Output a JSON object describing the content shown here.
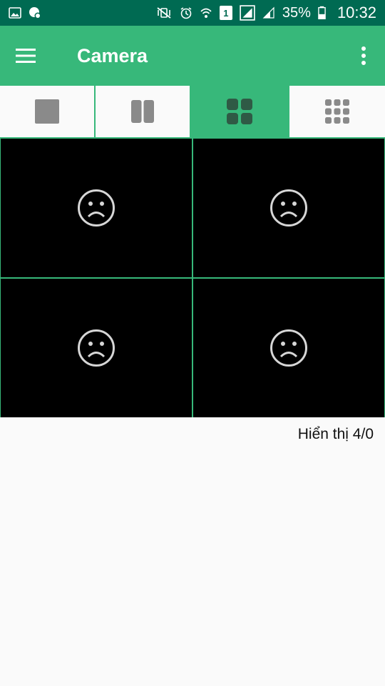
{
  "status_bar": {
    "battery_percent": "35%",
    "sim_label": "1",
    "time": "10:32"
  },
  "app_bar": {
    "title": "Camera",
    "menu_icon": "hamburger-menu-icon",
    "more_icon": "more-vert-icon"
  },
  "layout_tabs": [
    {
      "icon": "layout-1x1-icon",
      "selected": false
    },
    {
      "icon": "layout-1x2-icon",
      "selected": false
    },
    {
      "icon": "layout-2x2-icon",
      "selected": true
    },
    {
      "icon": "layout-3x3-icon",
      "selected": false
    }
  ],
  "cameras": [
    {
      "state_icon": "sad-face-icon"
    },
    {
      "state_icon": "sad-face-icon"
    },
    {
      "state_icon": "sad-face-icon"
    },
    {
      "state_icon": "sad-face-icon"
    }
  ],
  "display_status": "Hiển thị 4/0",
  "colors": {
    "status_bar": "#006a52",
    "accent": "#37b87a",
    "background": "#fafafa",
    "camera_bg": "#000000",
    "tab_icon_gray": "#8a8a8a",
    "tab_icon_selected": "#2f5a45"
  }
}
